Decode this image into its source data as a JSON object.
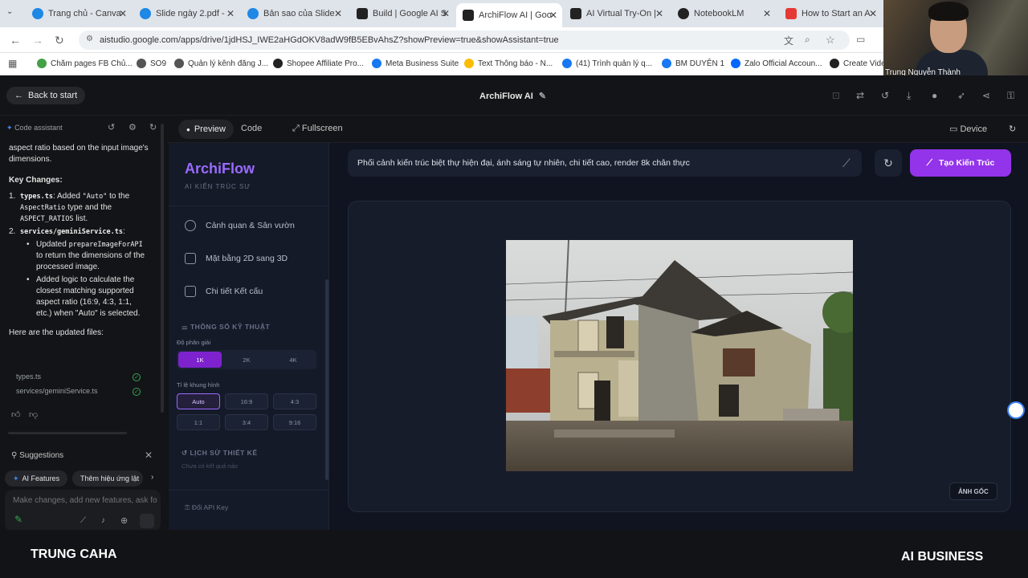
{
  "browser": {
    "tabs": [
      {
        "title": "Trang chủ - Canva",
        "color": "#1e88e5"
      },
      {
        "title": "Slide ngày 2.pdf -",
        "color": "#1e88e5"
      },
      {
        "title": "Bản sao của Slide",
        "color": "#1e88e5"
      },
      {
        "title": "Build | Google AI S",
        "color": "#222222"
      },
      {
        "title": "ArchiFlow AI | Goo",
        "color": "#222222"
      },
      {
        "title": "AI Virtual Try-On |",
        "color": "#222222"
      },
      {
        "title": "NotebookLM",
        "color": "#222222"
      },
      {
        "title": "How to Start an A",
        "color": "#e53935"
      }
    ],
    "url": "aistudio.google.com/apps/drive/1jdHSJ_IWE2aHGdOKV8adW9fB5EBvAhsZ?showPreview=true&showAssistant=true",
    "bookmarks": [
      {
        "label": "Chăm pages FB Chủ...",
        "color": "#43a047"
      },
      {
        "label": "SO9",
        "color": "#555555"
      },
      {
        "label": "Quản lý kênh đăng J...",
        "color": "#555555"
      },
      {
        "label": "Shopee Affiliate Pro...",
        "color": "#222222"
      },
      {
        "label": "Meta Business Suite",
        "color": "#1877f2"
      },
      {
        "label": "Text Thông báo - N...",
        "color": "#fbbc04"
      },
      {
        "label": "(41) Trình quản lý q...",
        "color": "#1877f2"
      },
      {
        "label": "BM DUYÊN 1",
        "color": "#1877f2"
      },
      {
        "label": "Zalo Official Accoun...",
        "color": "#0068ff"
      },
      {
        "label": "Create Vide",
        "color": "#222222"
      }
    ]
  },
  "webcam": {
    "name": "Trung Nguyễn Thành"
  },
  "app_header": {
    "back": "Back to start",
    "title": "ArchiFlow AI"
  },
  "chat": {
    "header": "Code assistant",
    "intro": "aspect ratio based on the input image's dimensions.",
    "key_changes": "Key Changes:",
    "item1_file": "types.ts",
    "item1_a": ": Added ",
    "item1_code1": "\"Auto\"",
    "item1_b": " to the ",
    "item1_code2": "AspectRatio",
    "item1_c": " type and the ",
    "item1_code3": "ASPECT_RATIOS",
    "item1_d": " list.",
    "item2_file": "services/geminiService.ts",
    "item2_colon": ":",
    "sub1_a": "Updated ",
    "sub1_code": "prepareImageForAPI",
    "sub1_b": " to return the dimensions of the processed image.",
    "sub2": "Added logic to calculate the closest matching supported aspect ratio (16:9, 4:3, 1:1, etc.) when \"Auto\" is selected.",
    "updated_files": "Here are the updated files:",
    "files": [
      "types.ts",
      "services/geminiService.ts"
    ],
    "suggestions_title": "Suggestions",
    "chips": [
      "AI Features",
      "Thêm hiệu ứng lật"
    ],
    "input_placeholder": "Make changes, add new features, ask for anything"
  },
  "preview_toolbar": {
    "preview": "Preview",
    "code": "Code",
    "fullscreen": "Fullscreen",
    "device": "Device"
  },
  "archiflow": {
    "logo": "ArchiFlow",
    "subtitle": "AI KIẾN TRÚC SƯ",
    "nav": [
      "Cảnh quan & Sân vườn",
      "Mặt bằng 2D sang 3D",
      "Chi tiết Kết cấu"
    ],
    "specs_title": "THÔNG SỐ KỸ THUẬT",
    "resolution_label": "Độ phân giải",
    "resolutions": [
      "1K",
      "2K",
      "4K"
    ],
    "resolution_selected": "1K",
    "aspect_label": "Tỉ lệ khung hình",
    "aspects": [
      "Auto",
      "16:9",
      "4:3",
      "1:1",
      "3:4",
      "9:16"
    ],
    "aspect_selected": "Auto",
    "history_title": "LỊCH SỬ THIẾT KẾ",
    "history_empty": "Chưa có kết quả nào",
    "api_key": "Đổi API Key",
    "prompt": "Phối cảnh kiến trúc biệt thự hiện đại, ánh sáng tự nhiên, chi tiết cao, render 8k chân thực",
    "generate": "Tạo Kiến Trúc",
    "original_badge": "ẢNH GỐC",
    "accent": "#9333ea"
  },
  "footer": {
    "left": "TRUNG CAHA",
    "right": "AI BUSINESS"
  }
}
